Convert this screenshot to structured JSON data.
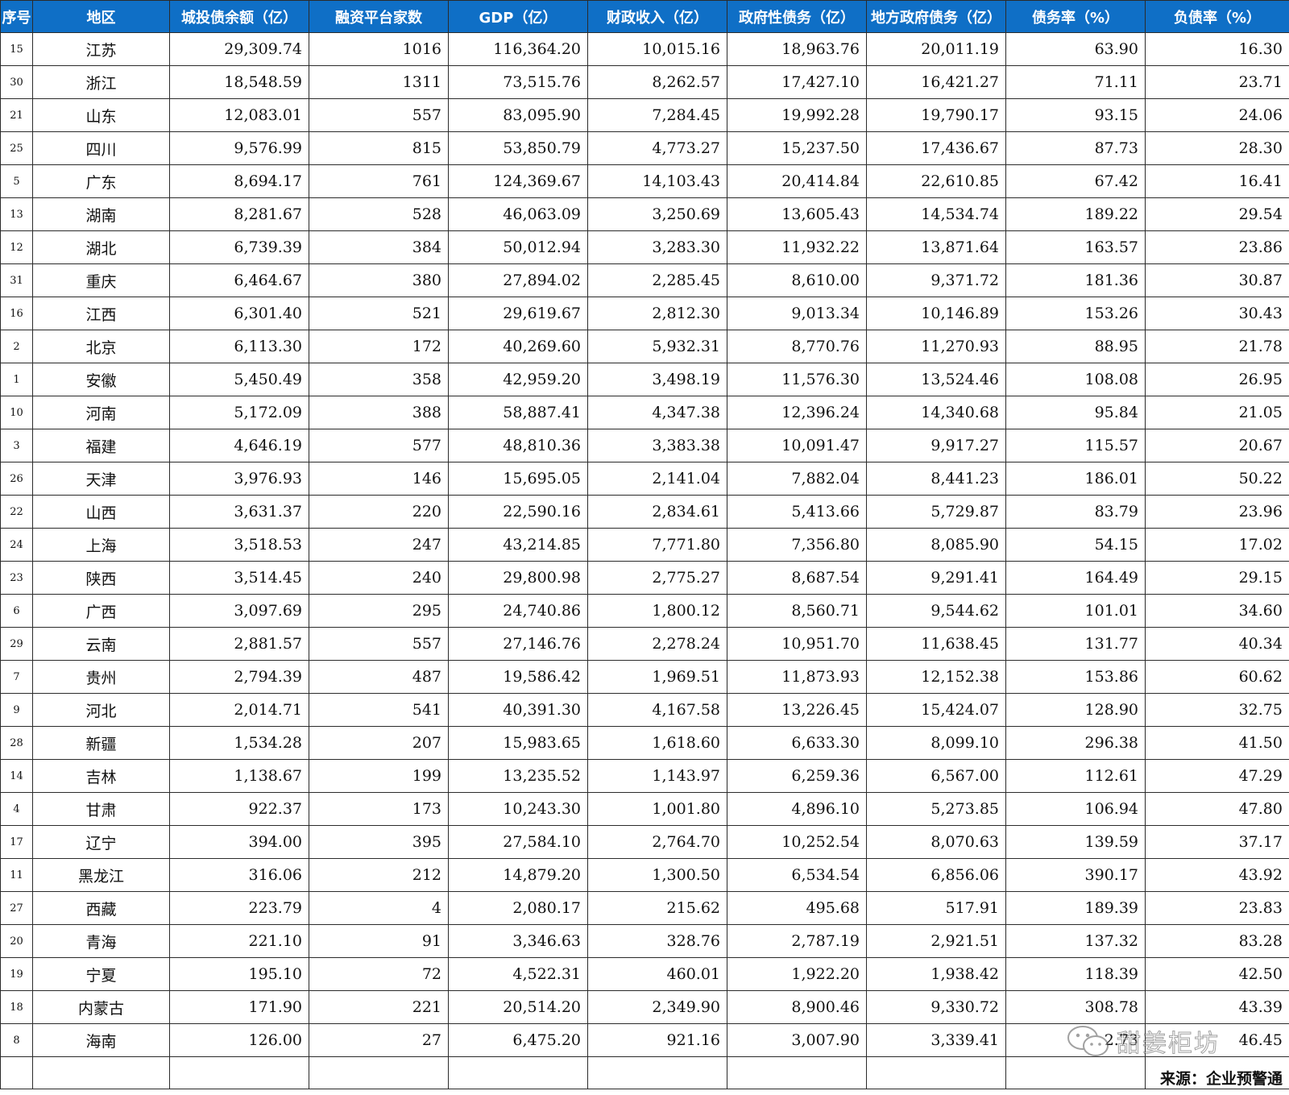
{
  "table": {
    "headers": [
      "序号",
      "地区",
      "城投债余额（亿）",
      "融资平台家数",
      "GDP（亿）",
      "财政收入（亿）",
      "政府性债务（亿）",
      "地方政府债务（亿）",
      "债务率（%）",
      "负债率（%）"
    ],
    "rows": [
      [
        "15",
        "江苏",
        "29,309.74",
        "1016",
        "116,364.20",
        "10,015.16",
        "18,963.76",
        "20,011.19",
        "63.90",
        "16.30"
      ],
      [
        "30",
        "浙江",
        "18,548.59",
        "1311",
        "73,515.76",
        "8,262.57",
        "17,427.10",
        "16,421.27",
        "71.11",
        "23.71"
      ],
      [
        "21",
        "山东",
        "12,083.01",
        "557",
        "83,095.90",
        "7,284.45",
        "19,992.28",
        "19,790.17",
        "93.15",
        "24.06"
      ],
      [
        "25",
        "四川",
        "9,576.99",
        "815",
        "53,850.79",
        "4,773.27",
        "15,237.50",
        "17,436.67",
        "87.73",
        "28.30"
      ],
      [
        "5",
        "广东",
        "8,694.17",
        "761",
        "124,369.67",
        "14,103.43",
        "20,414.84",
        "22,610.85",
        "67.42",
        "16.41"
      ],
      [
        "13",
        "湖南",
        "8,281.67",
        "528",
        "46,063.09",
        "3,250.69",
        "13,605.43",
        "14,534.74",
        "189.22",
        "29.54"
      ],
      [
        "12",
        "湖北",
        "6,739.39",
        "384",
        "50,012.94",
        "3,283.30",
        "11,932.22",
        "13,871.64",
        "163.57",
        "23.86"
      ],
      [
        "31",
        "重庆",
        "6,464.67",
        "380",
        "27,894.02",
        "2,285.45",
        "8,610.00",
        "9,371.72",
        "181.36",
        "30.87"
      ],
      [
        "16",
        "江西",
        "6,301.40",
        "521",
        "29,619.67",
        "2,812.30",
        "9,013.34",
        "10,146.89",
        "153.26",
        "30.43"
      ],
      [
        "2",
        "北京",
        "6,113.30",
        "172",
        "40,269.60",
        "5,932.31",
        "8,770.76",
        "11,270.93",
        "88.95",
        "21.78"
      ],
      [
        "1",
        "安徽",
        "5,450.49",
        "358",
        "42,959.20",
        "3,498.19",
        "11,576.30",
        "13,524.46",
        "108.08",
        "26.95"
      ],
      [
        "10",
        "河南",
        "5,172.09",
        "388",
        "58,887.41",
        "4,347.38",
        "12,396.24",
        "14,340.68",
        "95.84",
        "21.05"
      ],
      [
        "3",
        "福建",
        "4,646.19",
        "577",
        "48,810.36",
        "3,383.38",
        "10,091.47",
        "9,917.27",
        "115.57",
        "20.67"
      ],
      [
        "26",
        "天津",
        "3,976.93",
        "146",
        "15,695.05",
        "2,141.04",
        "7,882.04",
        "8,441.23",
        "186.01",
        "50.22"
      ],
      [
        "22",
        "山西",
        "3,631.37",
        "220",
        "22,590.16",
        "2,834.61",
        "5,413.66",
        "5,729.87",
        "83.79",
        "23.96"
      ],
      [
        "24",
        "上海",
        "3,518.53",
        "247",
        "43,214.85",
        "7,771.80",
        "7,356.80",
        "8,085.90",
        "54.15",
        "17.02"
      ],
      [
        "23",
        "陕西",
        "3,514.45",
        "240",
        "29,800.98",
        "2,775.27",
        "8,687.54",
        "9,291.41",
        "164.49",
        "29.15"
      ],
      [
        "6",
        "广西",
        "3,097.69",
        "295",
        "24,740.86",
        "1,800.12",
        "8,560.71",
        "9,544.62",
        "101.01",
        "34.60"
      ],
      [
        "29",
        "云南",
        "2,881.57",
        "557",
        "27,146.76",
        "2,278.24",
        "10,951.70",
        "11,638.45",
        "131.77",
        "40.34"
      ],
      [
        "7",
        "贵州",
        "2,794.39",
        "487",
        "19,586.42",
        "1,969.51",
        "11,873.93",
        "12,152.38",
        "153.86",
        "60.62"
      ],
      [
        "9",
        "河北",
        "2,014.71",
        "541",
        "40,391.30",
        "4,167.58",
        "13,226.45",
        "15,424.07",
        "128.90",
        "32.75"
      ],
      [
        "28",
        "新疆",
        "1,534.28",
        "207",
        "15,983.65",
        "1,618.60",
        "6,633.30",
        "8,099.10",
        "296.38",
        "41.50"
      ],
      [
        "14",
        "吉林",
        "1,138.67",
        "199",
        "13,235.52",
        "1,143.97",
        "6,259.36",
        "6,567.00",
        "112.61",
        "47.29"
      ],
      [
        "4",
        "甘肃",
        "922.37",
        "173",
        "10,243.30",
        "1,001.80",
        "4,896.10",
        "5,273.85",
        "106.94",
        "47.80"
      ],
      [
        "17",
        "辽宁",
        "394.00",
        "395",
        "27,584.10",
        "2,764.70",
        "10,252.54",
        "8,070.63",
        "139.59",
        "37.17"
      ],
      [
        "11",
        "黑龙江",
        "316.06",
        "212",
        "14,879.20",
        "1,300.50",
        "6,534.54",
        "6,856.06",
        "390.17",
        "43.92"
      ],
      [
        "27",
        "西藏",
        "223.79",
        "4",
        "2,080.17",
        "215.62",
        "495.68",
        "517.91",
        "189.39",
        "23.83"
      ],
      [
        "20",
        "青海",
        "221.10",
        "91",
        "3,346.63",
        "328.76",
        "2,787.19",
        "2,921.51",
        "137.32",
        "83.28"
      ],
      [
        "19",
        "宁夏",
        "195.10",
        "72",
        "4,522.31",
        "460.01",
        "1,922.20",
        "1,938.42",
        "118.39",
        "42.50"
      ],
      [
        "18",
        "内蒙古",
        "171.90",
        "221",
        "20,514.20",
        "2,349.90",
        "8,900.46",
        "9,330.72",
        "308.78",
        "43.39"
      ],
      [
        "8",
        "海南",
        "126.00",
        "27",
        "6,475.20",
        "921.16",
        "3,007.90",
        "3,339.41",
        "2.73",
        "46.45"
      ]
    ]
  },
  "source_note": "来源：企业预警通",
  "watermark": {
    "text": "甜姜柜坊",
    "icon": "wechat-logo-icon"
  }
}
